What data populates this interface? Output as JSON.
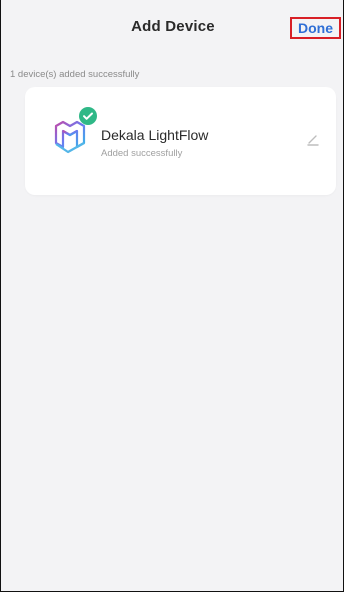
{
  "header": {
    "title": "Add Device",
    "done_label": "Done"
  },
  "status": {
    "message": "1 device(s) added successfully"
  },
  "device": {
    "name": "Dekala LightFlow",
    "status": "Added successfully",
    "icon": "device-logo-icon",
    "badge_icon": "check-icon",
    "edit_icon": "edit-icon"
  },
  "colors": {
    "background": "#f3f3f5",
    "done_text": "#2f6fd6",
    "done_border": "#d81f26",
    "success_badge": "#2fb887"
  }
}
